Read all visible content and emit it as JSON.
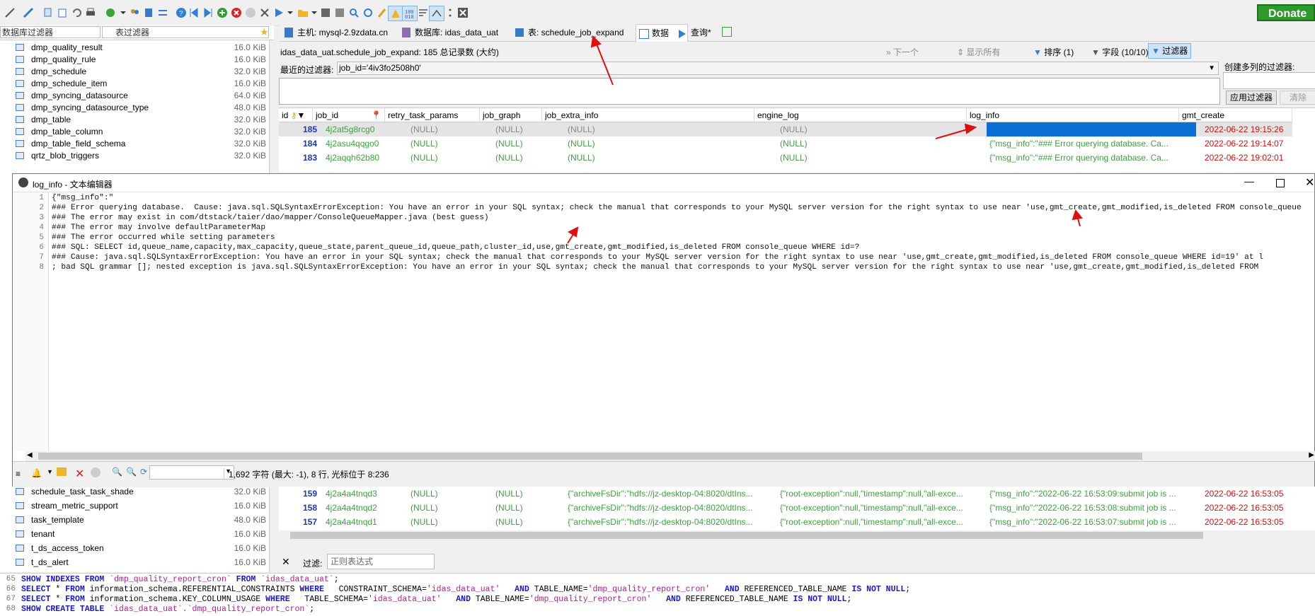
{
  "toolbar": {
    "donate_label": "Donate"
  },
  "left_panel": {
    "db_filter_placeholder": "数据库过滤器",
    "table_filter_placeholder": "表过滤器",
    "tables_top": [
      {
        "name": "dmp_quality_result",
        "size": "16.0 KiB"
      },
      {
        "name": "dmp_quality_rule",
        "size": "16.0 KiB"
      },
      {
        "name": "dmp_schedule",
        "size": "32.0 KiB"
      },
      {
        "name": "dmp_schedule_item",
        "size": "16.0 KiB"
      },
      {
        "name": "dmp_syncing_datasource",
        "size": "64.0 KiB"
      },
      {
        "name": "dmp_syncing_datasource_type",
        "size": "48.0 KiB"
      },
      {
        "name": "dmp_table",
        "size": "32.0 KiB"
      },
      {
        "name": "dmp_table_column",
        "size": "32.0 KiB"
      },
      {
        "name": "dmp_table_field_schema",
        "size": "32.0 KiB"
      },
      {
        "name": "qrtz_blob_triggers",
        "size": "32.0 KiB"
      }
    ],
    "tables_bottom": [
      {
        "name": "schedule_task_task_shade",
        "size": "32.0 KiB"
      },
      {
        "name": "stream_metric_support",
        "size": "16.0 KiB"
      },
      {
        "name": "task_template",
        "size": "48.0 KiB"
      },
      {
        "name": "tenant",
        "size": "16.0 KiB"
      },
      {
        "name": "t_ds_access_token",
        "size": "16.0 KiB"
      },
      {
        "name": "t_ds_alert",
        "size": "16.0 KiB"
      }
    ]
  },
  "tabs": [
    {
      "label": "主机: mysql-2.9zdata.cn"
    },
    {
      "label": "数据库: idas_data_uat"
    },
    {
      "label": "表: schedule_job_expand"
    },
    {
      "label": "数据"
    },
    {
      "label": "查询*"
    }
  ],
  "data_panel": {
    "info": "idas_data_uat.schedule_job_expand: 185 总记录数 (大约)",
    "next_label": "下一个",
    "show_all_label": "显示所有",
    "sort_label": "排序 (1)",
    "fields_label": "字段 (10/10)",
    "filter_label": "过滤器",
    "recent_filters_label": "最近的过滤器:",
    "recent_filter_value": "job_id='4iv3fo2508h0'",
    "create_multi_filter_label": "创建多列的过滤器:",
    "apply_filter_label": "应用过滤器",
    "clear_label": "清除"
  },
  "grid": {
    "columns": [
      "id",
      "job_id",
      "retry_task_params",
      "job_graph",
      "job_extra_info",
      "engine_log",
      "log_info",
      "gmt_create"
    ],
    "rows": [
      {
        "id": "185",
        "job_id": "4j2at5g8rcg0",
        "retry": "(NULL)",
        "graph": "(NULL)",
        "extra": "(NULL)",
        "engine": "(NULL)",
        "log": "",
        "created": "2022-06-22 19:15:26"
      },
      {
        "id": "184",
        "job_id": "4j2asu4qqgo0",
        "retry": "(NULL)",
        "graph": "(NULL)",
        "extra": "(NULL)",
        "engine": "(NULL)",
        "log": "{\"msg_info\":\"### Error querying database.  Ca...",
        "created": "2022-06-22 19:14:07"
      },
      {
        "id": "183",
        "job_id": "4j2aqqh62b80",
        "retry": "(NULL)",
        "graph": "(NULL)",
        "extra": "(NULL)",
        "engine": "(NULL)",
        "log": "{\"msg_info\":\"### Error querying database.  Ca...",
        "created": "2022-06-22 19:02:01"
      }
    ],
    "bottom_rows": [
      {
        "id": "159",
        "job_id": "4j2a4a4tnqd3",
        "retry": "(NULL)",
        "graph": "(NULL)",
        "extra": "{\"archiveFsDir\":\"hdfs://jz-desktop-04:8020/dtIns...",
        "engine": "{\"root-exception\":null,\"timestamp\":null,\"all-exce...",
        "log": "{\"msg_info\":\"2022-06-22 16:53:09:submit job is ...",
        "created": "2022-06-22 16:53:05"
      },
      {
        "id": "158",
        "job_id": "4j2a4a4tnqd2",
        "retry": "(NULL)",
        "graph": "(NULL)",
        "extra": "{\"archiveFsDir\":\"hdfs://jz-desktop-04:8020/dtIns...",
        "engine": "{\"root-exception\":null,\"timestamp\":null,\"all-exce...",
        "log": "{\"msg_info\":\"2022-06-22 16:53:08:submit job is ...",
        "created": "2022-06-22 16:53:05"
      },
      {
        "id": "157",
        "job_id": "4j2a4a4tnqd1",
        "retry": "(NULL)",
        "graph": "(NULL)",
        "extra": "{\"archiveFsDir\":\"hdfs://jz-desktop-04:8020/dtIns...",
        "engine": "{\"root-exception\":null,\"timestamp\":null,\"all-exce...",
        "log": "{\"msg_info\":\"2022-06-22 16:53:07:submit job is ...",
        "created": "2022-06-22 16:53:05"
      }
    ],
    "bottom_filter_label": "过滤:",
    "bottom_filter_placeholder": "正则表达式"
  },
  "editor": {
    "title": "log_info - 文本编辑器",
    "lines": [
      "{\"msg_info\":\"",
      "### Error querying database.  Cause: java.sql.SQLSyntaxErrorException: You have an error in your SQL syntax; check the manual that corresponds to your MySQL server version for the right syntax to use near 'use,gmt_create,gmt_modified,is_deleted FROM console_queue",
      "### The error may exist in com/dtstack/taier/dao/mapper/ConsoleQueueMapper.java (best guess)",
      "### The error may involve defaultParameterMap",
      "### The error occurred while setting parameters",
      "### SQL: SELECT id,queue_name,capacity,max_capacity,queue_state,parent_queue_id,queue_path,cluster_id,use,gmt_create,gmt_modified,is_deleted FROM console_queue WHERE id=?",
      "### Cause: java.sql.SQLSyntaxErrorException: You have an error in your SQL syntax; check the manual that corresponds to your MySQL server version for the right syntax to use near 'use,gmt_create,gmt_modified,is_deleted FROM console_queue WHERE id=19' at l",
      "; bad SQL grammar []; nested exception is java.sql.SQLSyntaxErrorException: You have an error in your SQL syntax; check the manual that corresponds to your MySQL server version for the right syntax to use near 'use,gmt_create,gmt_modified,is_deleted FROM"
    ],
    "status": "1,692 字符 (最大: -1), 8 行, 光标位于 8:236"
  },
  "sql_log": {
    "line_numbers": [
      "65",
      "66",
      "67",
      "68"
    ]
  }
}
